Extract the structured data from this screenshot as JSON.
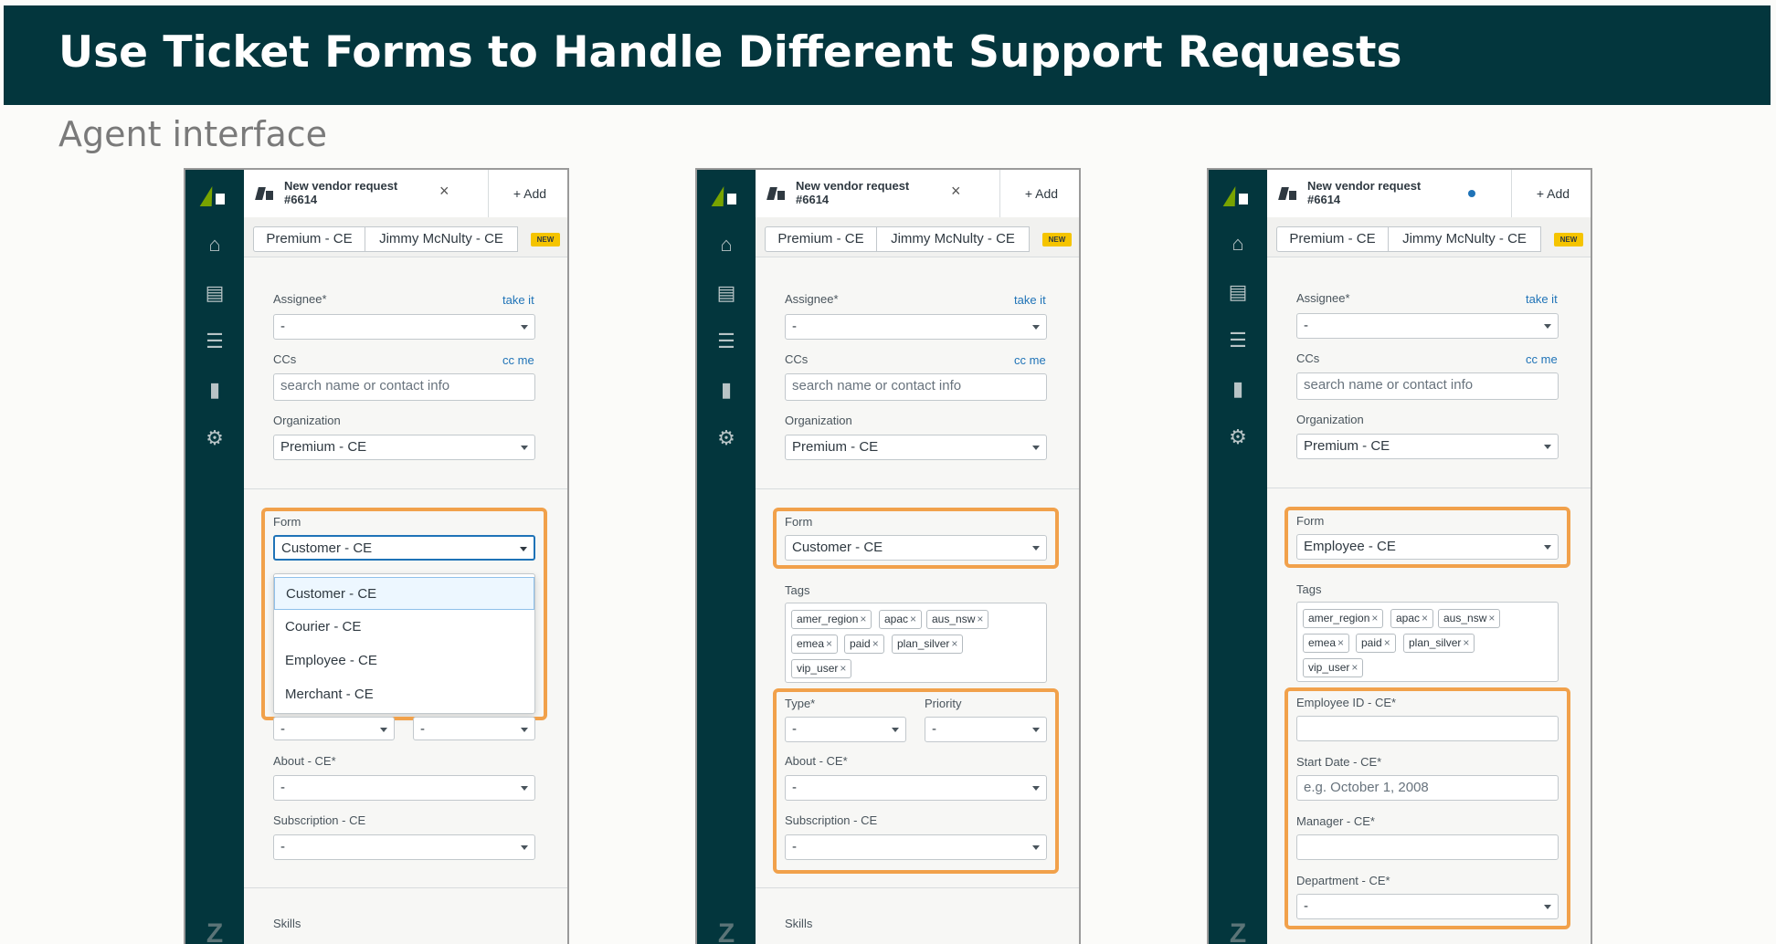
{
  "slide": {
    "title": "Use Ticket Forms to Handle Different Support Requests",
    "subtitle": "Agent interface"
  },
  "colors": {
    "header": "#03363d",
    "highlight": "#f1a14b",
    "link": "#1f73b7",
    "new_badge": "#f5c400"
  },
  "nav_icons": [
    "home-icon",
    "views-icon",
    "customers-icon",
    "reporting-icon",
    "admin-gear-icon",
    "zendesk-logo-icon"
  ],
  "panels": [
    {
      "tab": {
        "title": "New vendor request",
        "number": "#6614",
        "close": "×"
      },
      "add": "+ Add",
      "ctx": {
        "org": "Premium - CE",
        "user": "Jimmy McNulty - CE",
        "badge": "NEW"
      },
      "assignee": {
        "label": "Assignee*",
        "link": "take it",
        "value": "-"
      },
      "ccs": {
        "label": "CCs",
        "link": "cc me",
        "placeholder": "search name or contact info"
      },
      "organization": {
        "label": "Organization",
        "value": "Premium - CE"
      },
      "form": {
        "label": "Form",
        "value": "Customer - CE"
      },
      "dropdown": [
        "Customer - CE",
        "Courier - CE",
        "Employee - CE",
        "Merchant - CE"
      ],
      "type_value": "-",
      "priority_value": "-",
      "about": {
        "label": "About - CE*",
        "value": "-"
      },
      "subscription": {
        "label": "Subscription - CE",
        "value": "-"
      },
      "skills": "Skills"
    },
    {
      "tab": {
        "title": "New vendor request",
        "number": "#6614",
        "close": "×"
      },
      "add": "+ Add",
      "ctx": {
        "org": "Premium - CE",
        "user": "Jimmy McNulty - CE",
        "badge": "NEW"
      },
      "assignee": {
        "label": "Assignee*",
        "link": "take it",
        "value": "-"
      },
      "ccs": {
        "label": "CCs",
        "link": "cc me",
        "placeholder": "search name or contact info"
      },
      "organization": {
        "label": "Organization",
        "value": "Premium - CE"
      },
      "form": {
        "label": "Form",
        "value": "Customer - CE"
      },
      "tags_label": "Tags",
      "tags": [
        "amer_region",
        "apac",
        "aus_nsw",
        "emea",
        "paid",
        "plan_silver",
        "vip_user"
      ],
      "type": {
        "label": "Type*",
        "value": "-"
      },
      "priority": {
        "label": "Priority",
        "value": "-"
      },
      "about": {
        "label": "About - CE*",
        "value": "-"
      },
      "subscription": {
        "label": "Subscription - CE",
        "value": "-"
      },
      "skills": "Skills"
    },
    {
      "tab": {
        "title": "New vendor request",
        "number": "#6614"
      },
      "add": "+ Add",
      "ctx": {
        "org": "Premium - CE",
        "user": "Jimmy McNulty - CE",
        "badge": "NEW"
      },
      "assignee": {
        "label": "Assignee*",
        "link": "take it",
        "value": "-"
      },
      "ccs": {
        "label": "CCs",
        "link": "cc me",
        "placeholder": "search name or contact info"
      },
      "organization": {
        "label": "Organization",
        "value": "Premium - CE"
      },
      "form": {
        "label": "Form",
        "value": "Employee - CE"
      },
      "tags_label": "Tags",
      "tags": [
        "amer_region",
        "apac",
        "aus_nsw",
        "emea",
        "paid",
        "plan_silver",
        "vip_user"
      ],
      "employee_id": {
        "label": "Employee ID - CE*",
        "value": ""
      },
      "start_date": {
        "label": "Start Date - CE*",
        "placeholder": "e.g. October 1, 2008"
      },
      "manager": {
        "label": "Manager - CE*",
        "value": ""
      },
      "department": {
        "label": "Department - CE*",
        "value": "-"
      }
    }
  ]
}
